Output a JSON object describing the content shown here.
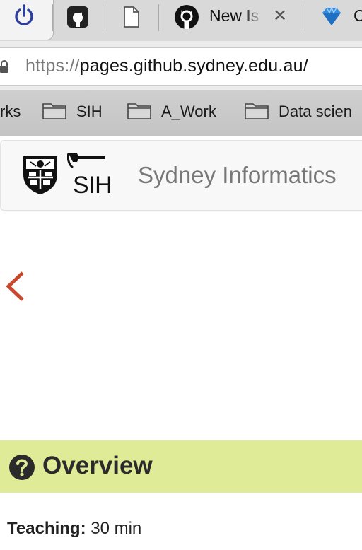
{
  "browser": {
    "tabs": [
      {
        "icon": "power-icon",
        "active": true
      },
      {
        "icon": "github-icon"
      },
      {
        "icon": "document-icon"
      },
      {
        "icon": "github-icon",
        "title": "New Is",
        "close": "✕"
      },
      {
        "icon": "diamond-icon",
        "title": "C"
      }
    ],
    "url_scheme": "https://",
    "url_host": "pages.github.sydney.edu.au/",
    "bookmarks": [
      {
        "label": "rks"
      },
      {
        "label": "SIH",
        "icon": "folder-icon"
      },
      {
        "label": "A_Work",
        "icon": "folder-icon"
      },
      {
        "label": "Data scien",
        "icon": "folder-icon"
      }
    ]
  },
  "site": {
    "logo_text": "SIH",
    "title": "Sydney Informatics"
  },
  "lesson": {
    "overview_title": "Overview",
    "teaching_label": "Teaching:",
    "teaching_value": " 30 min"
  },
  "colors": {
    "overview_bg": "#e0eb98",
    "prev_arrow": "#c8472d",
    "power_icon": "#2c3e9e"
  }
}
